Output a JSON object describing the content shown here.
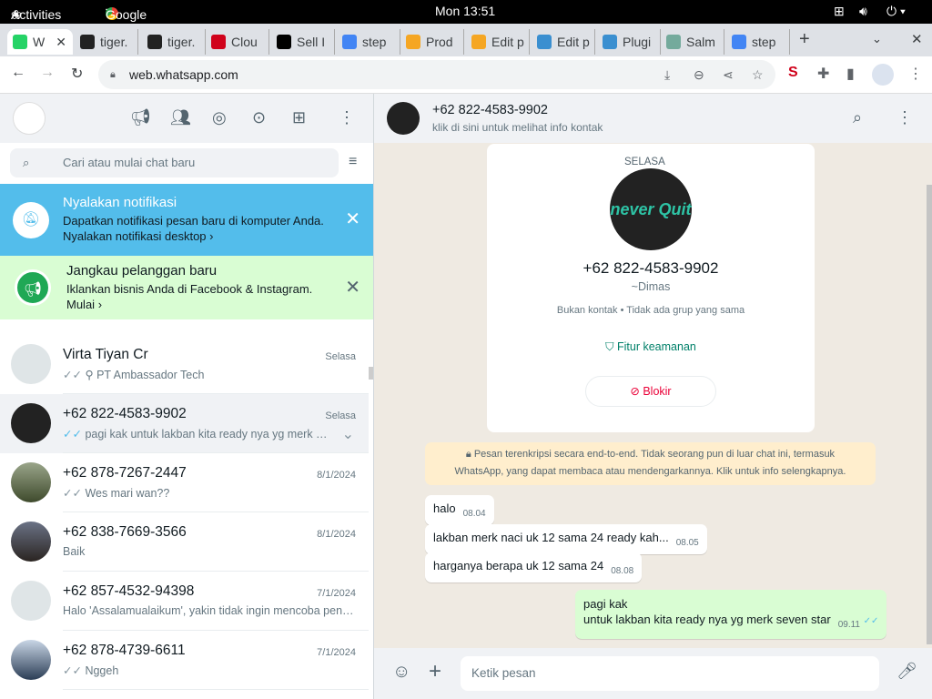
{
  "system": {
    "activities": "Activities",
    "app": "Google Chrome",
    "clock": "Mon 13:51"
  },
  "tabs": [
    {
      "label": "W",
      "color": "#25d366"
    },
    {
      "label": "tiger.",
      "color": "#222"
    },
    {
      "label": "tiger.",
      "color": "#222"
    },
    {
      "label": "Clou",
      "color": "#d0021b"
    },
    {
      "label": "Sell I",
      "color": "#000"
    },
    {
      "label": "step",
      "color": "#4285f4"
    },
    {
      "label": "Prod",
      "color": "#f5a623"
    },
    {
      "label": "Edit p",
      "color": "#f5a623"
    },
    {
      "label": "Edit p",
      "color": "#3a8fd0"
    },
    {
      "label": "Plugi",
      "color": "#3a8fd0"
    },
    {
      "label": "Salm",
      "color": "#74aa9c"
    },
    {
      "label": "step",
      "color": "#4285f4"
    }
  ],
  "browser": {
    "url": "web.whatsapp.com"
  },
  "left": {
    "search_placeholder": "Cari atau mulai chat baru",
    "notif": {
      "title": "Nyalakan notifikasi",
      "text": "Dapatkan notifikasi pesan baru di komputer Anda.",
      "link": "Nyalakan notifikasi desktop"
    },
    "promo": {
      "title": "Jangkau pelanggan baru",
      "text": "Iklankan bisnis Anda di Facebook & Instagram.",
      "link": "Mulai"
    },
    "chats": [
      {
        "name": "Virta Tiyan Cr",
        "time": "Selasa",
        "msg": "PT Ambassador Tech"
      },
      {
        "name": "+62 822-4583-9902",
        "time": "Selasa",
        "msg": "pagi kak untuk lakban kita ready nya yg merk seven star"
      },
      {
        "name": "+62 878-7267-2447",
        "time": "8/1/2024",
        "msg": "Wes mari wan??"
      },
      {
        "name": "+62 838-7669-3566",
        "time": "8/1/2024",
        "msg": "Baik"
      },
      {
        "name": "+62 857-4532-94398",
        "time": "7/1/2024",
        "msg": "Halo 'Assalamualaikum', yakin tidak ingin mencoba penawaran kami"
      },
      {
        "name": "+62 878-4739-6611",
        "time": "7/1/2024",
        "msg": "Nggeh"
      }
    ]
  },
  "chat": {
    "name": "+62 822-4583-9902",
    "subtitle": "klik di sini untuk melihat info kontak",
    "day": "SELASA",
    "card_number": "+62 822-4583-9902",
    "card_name": "~Dimas",
    "card_info": "Bukan kontak • Tidak ada grup yang sama",
    "security": "Fitur keamanan",
    "block": "Blokir",
    "logo_text": "never Quit",
    "encryption": "Pesan terenkripsi secara end-to-end. Tidak seorang pun di luar chat ini, termasuk WhatsApp, yang dapat membaca atau mendengarkannya. Klik untuk info selengkapnya.",
    "messages": [
      {
        "text": "halo",
        "time": "08.04"
      },
      {
        "text": "lakban merk naci uk 12 sama 24 ready kah...",
        "time": "08.05"
      },
      {
        "text": "harganya berapa uk 12 sama 24",
        "time": "08.08"
      },
      {
        "line1": "pagi kak",
        "line2": "untuk lakban kita ready nya yg merk seven star",
        "time": "09.11"
      }
    ],
    "input_placeholder": "Ketik pesan"
  }
}
